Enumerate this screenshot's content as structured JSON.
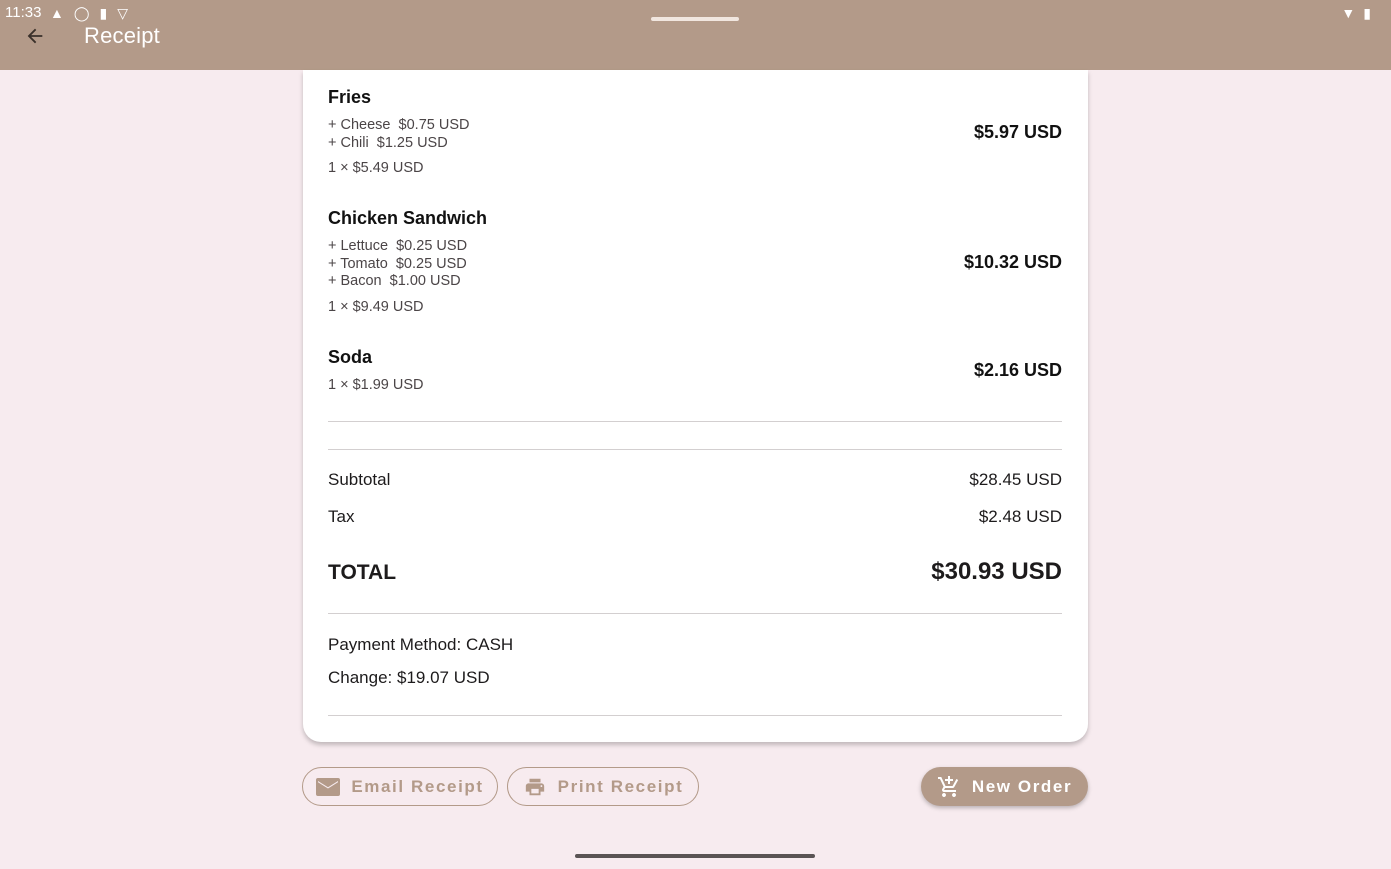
{
  "status_bar": {
    "time": "11:33"
  },
  "header": {
    "title": "Receipt"
  },
  "items": [
    {
      "name": "Fries",
      "modifiers": [
        "+ Cheese  $0.75 USD",
        "+ Chili  $1.25 USD"
      ],
      "quantity_line": "1 × $5.49 USD",
      "price": "$5.97 USD"
    },
    {
      "name": "Chicken Sandwich",
      "modifiers": [
        "+ Lettuce  $0.25 USD",
        "+ Tomato  $0.25 USD",
        "+ Bacon  $1.00 USD"
      ],
      "quantity_line": "1 × $9.49 USD",
      "price": "$10.32 USD"
    },
    {
      "name": "Soda",
      "modifiers": [],
      "quantity_line": "1 × $1.99 USD",
      "price": "$2.16 USD"
    }
  ],
  "totals": {
    "subtotal_label": "Subtotal",
    "subtotal_value": "$28.45 USD",
    "tax_label": "Tax",
    "tax_value": "$2.48 USD",
    "total_label": "TOTAL",
    "total_value": "$30.93 USD"
  },
  "payment": {
    "method": "Payment Method: CASH",
    "change": "Change: $19.07 USD"
  },
  "actions": {
    "email_label": "Email Receipt",
    "print_label": "Print Receipt",
    "new_order_label": "New Order"
  },
  "colors": {
    "accent": "#b39a89",
    "background": "#f7ebef",
    "card": "#ffffff"
  }
}
